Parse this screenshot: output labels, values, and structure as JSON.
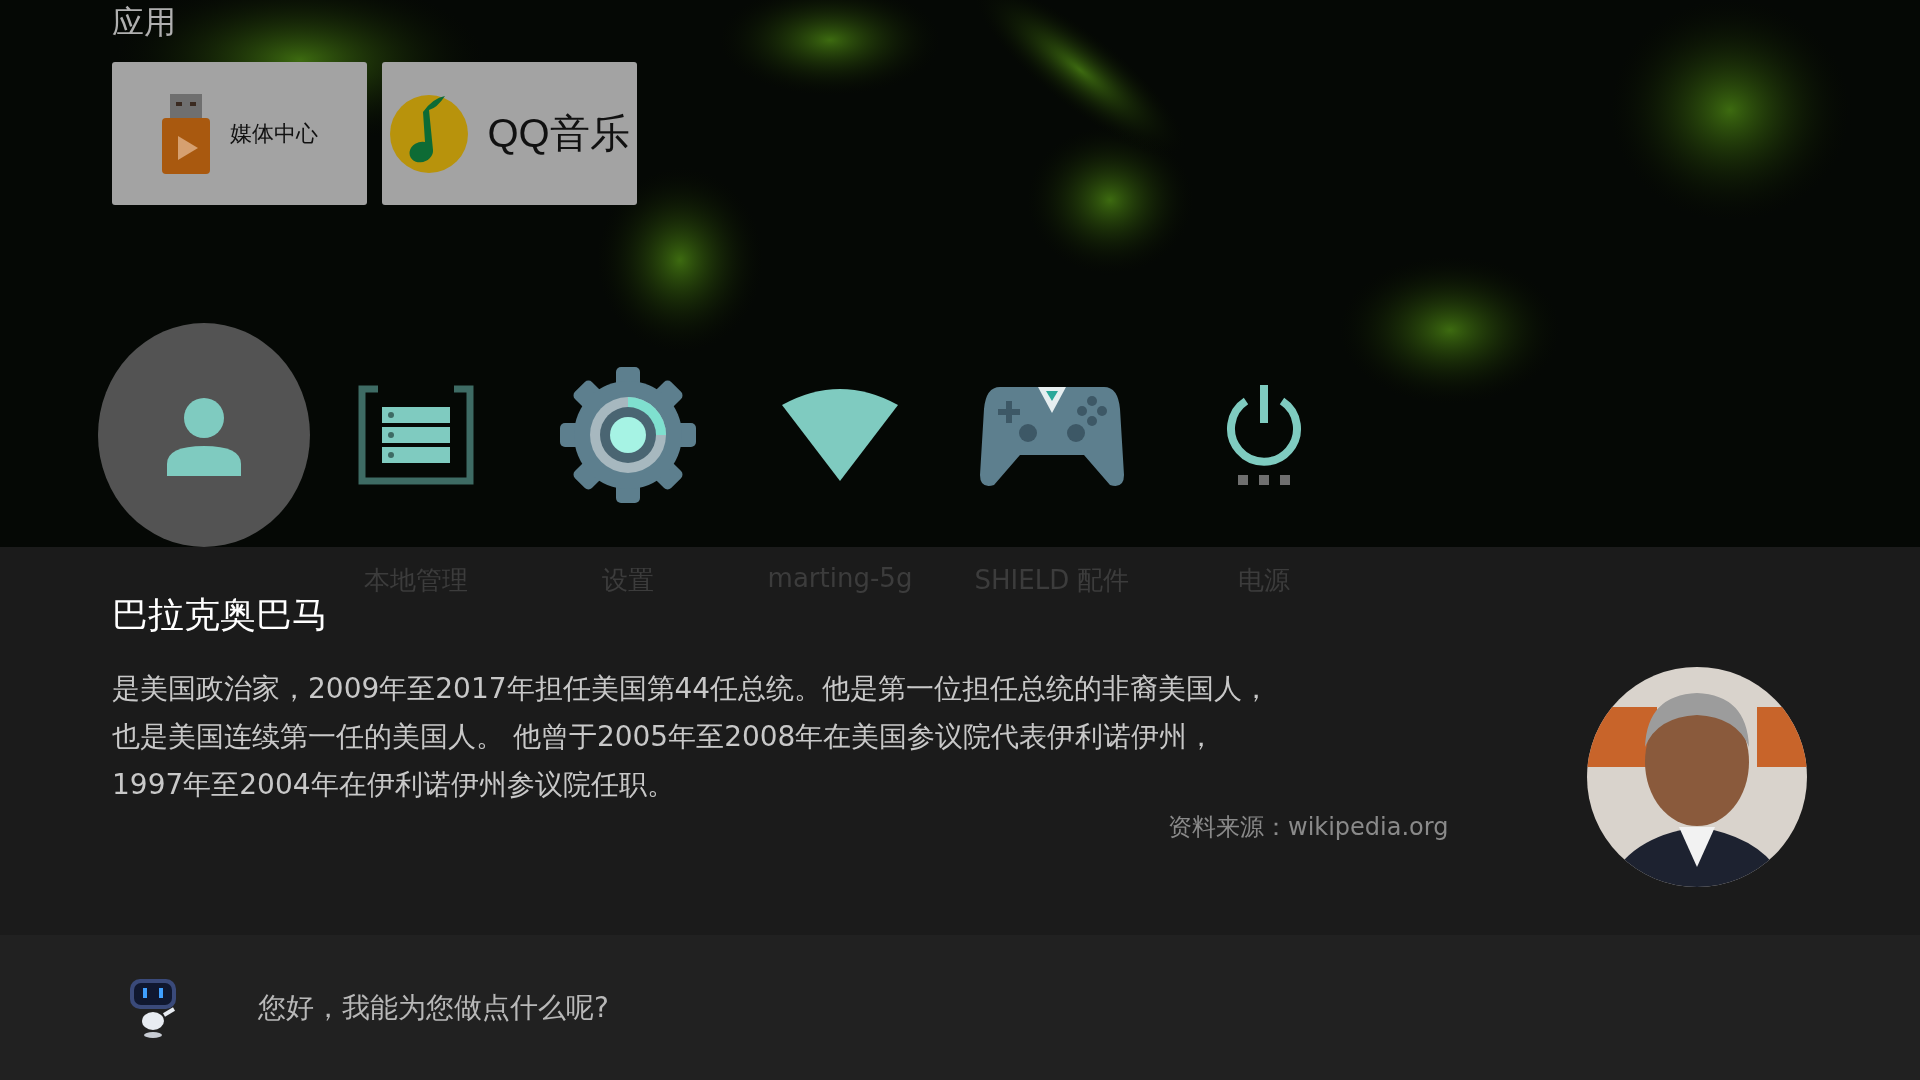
{
  "section_title": "应用",
  "apps": [
    {
      "kind": "media",
      "label": "媒体中心"
    },
    {
      "kind": "music",
      "label": "QQ音乐"
    }
  ],
  "shortcuts": [
    {
      "kind": "account",
      "selected": true
    },
    {
      "kind": "storage",
      "selected": false,
      "label": "本地管理"
    },
    {
      "kind": "settings",
      "selected": false,
      "label": "设置"
    },
    {
      "kind": "wifi",
      "selected": false,
      "label": "marting-5g"
    },
    {
      "kind": "gamepad",
      "selected": false,
      "label": "SHIELD 配件"
    },
    {
      "kind": "power",
      "selected": false,
      "label": "电源"
    }
  ],
  "info": {
    "title": "巴拉克奥巴马",
    "lines": [
      "是美国政治家，2009年至2017年担任美国第44任总统。他是第一位担任总统的非裔美国人，",
      "也是美国连续第一任的美国人。 他曾于2005年至2008年在美国参议院代表伊利诺伊州，",
      "1997年至2004年在伊利诺伊州参议院任职。"
    ],
    "source": "资料来源：wikipedia.org"
  },
  "assistant": {
    "prompt": "您好，我能为您做点什么呢?"
  }
}
